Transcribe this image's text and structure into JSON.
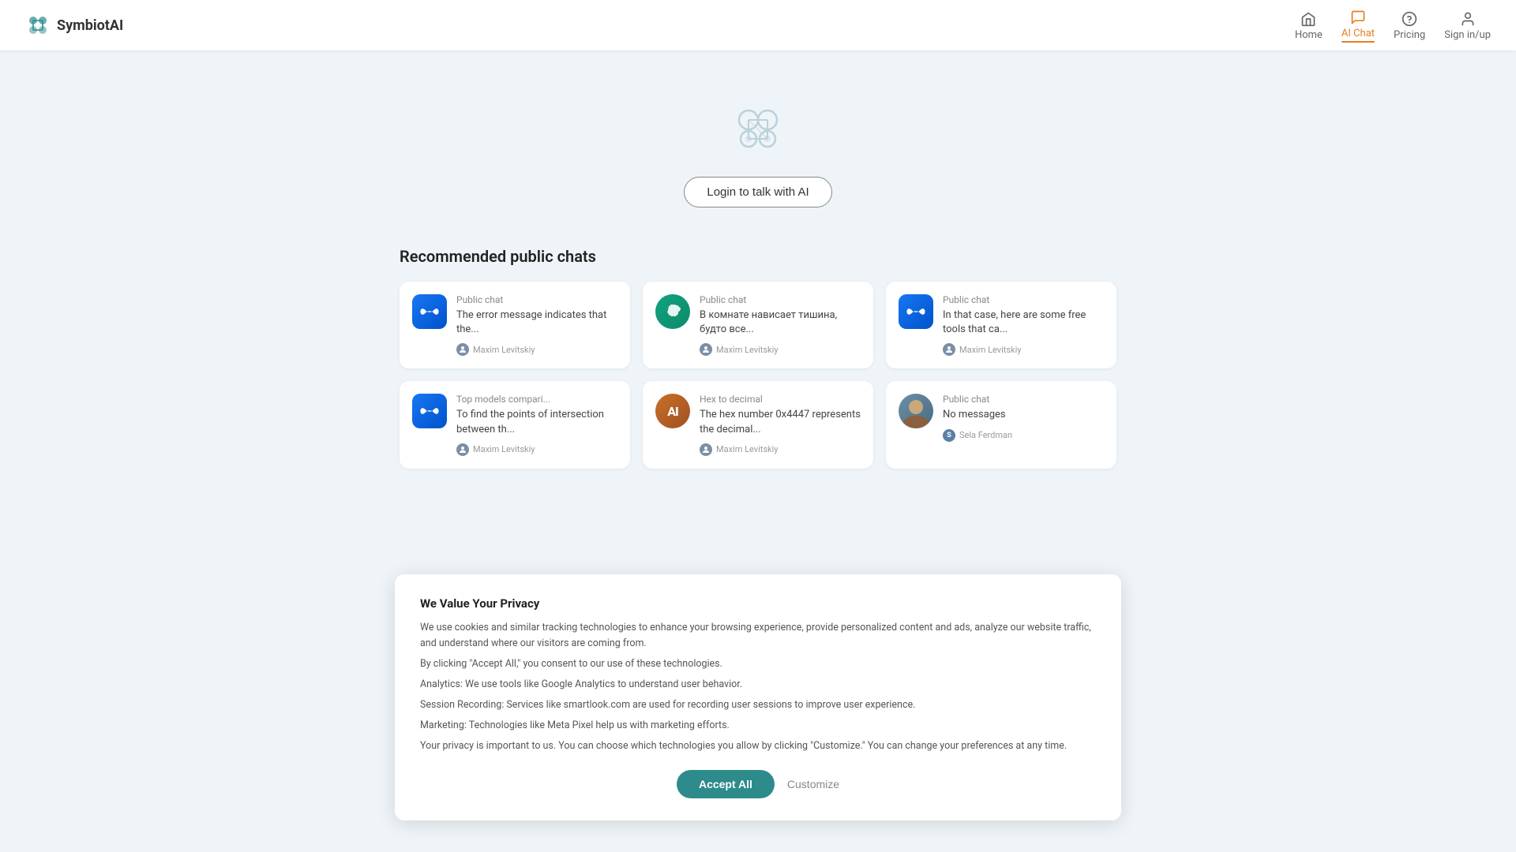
{
  "brand": {
    "name": "SymbiotAI"
  },
  "nav": {
    "home_label": "Home",
    "aichat_label": "AI Chat",
    "pricing_label": "Pricing",
    "signin_label": "Sign in/up"
  },
  "hero": {
    "login_button": "Login to talk with AI"
  },
  "recommended": {
    "section_title": "Recommended public chats",
    "cards": [
      {
        "type": "Public chat",
        "title": "Public chat",
        "preview": "The error message indicates that the...",
        "author": "Maxim Levitskiy",
        "avatar_type": "meta",
        "author_color": "#7a8fa6"
      },
      {
        "type": "Public chat",
        "title": "Public chat",
        "preview": "В комнате нависает тишина, будто все...",
        "author": "Maxim Levitskiy",
        "avatar_type": "gpt",
        "author_color": "#7a8fa6"
      },
      {
        "type": "Public chat",
        "title": "Public chat",
        "preview": "In that case, here are some free tools that ca...",
        "author": "Maxim Levitskiy",
        "avatar_type": "meta",
        "author_color": "#7a8fa6"
      },
      {
        "type": "Top models compari...",
        "title": "Top models compari...",
        "preview": "To find the points of intersection between th...",
        "author": "Maxim Levitskiy",
        "avatar_type": "meta",
        "author_color": "#7a8fa6"
      },
      {
        "type": "Hex to decimal",
        "title": "Hex to decimal",
        "preview": "The hex number 0x4447 represents the decimal...",
        "author": "Maxim Levitskiy",
        "avatar_type": "al",
        "author_color": "#7a8fa6"
      },
      {
        "type": "Public chat",
        "title": "Public chat",
        "preview": "No messages",
        "author": "Sela Ferdman",
        "avatar_type": "sela",
        "author_color": "#5b7fa6"
      }
    ]
  },
  "privacy": {
    "title": "We Value Your Privacy",
    "body1": "We use cookies and similar tracking technologies to enhance your browsing experience, provide personalized content and ads, analyze our website traffic, and understand where our visitors are coming from.",
    "body2": "By clicking \"Accept All,\" you consent to our use of these technologies.",
    "analytics": "Analytics: We use tools like Google Analytics to understand user behavior.",
    "session": "Session Recording: Services like smartlook.com are used for recording user sessions to improve user experience.",
    "marketing": "Marketing: Technologies like Meta Pixel help us with marketing efforts.",
    "privacy_note": "Your privacy is important to us. You can choose which technologies you allow by clicking \"Customize.\" You can change your preferences at any time.",
    "accept_label": "Accept All",
    "customize_label": "Customize"
  }
}
